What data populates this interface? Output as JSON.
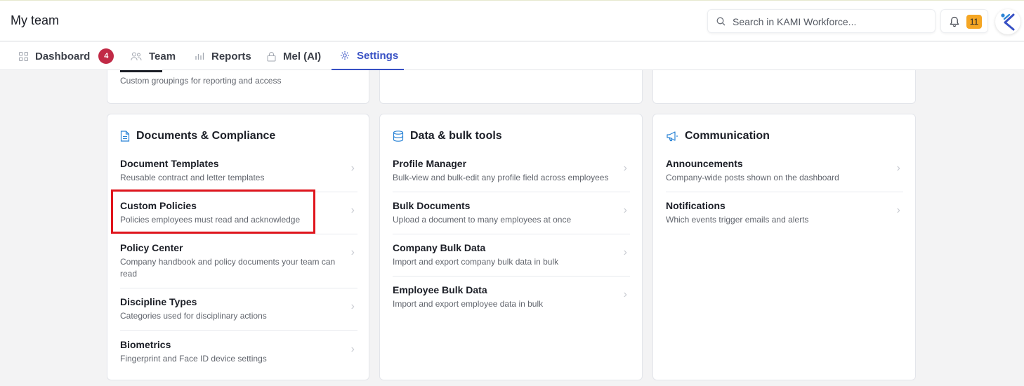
{
  "header": {
    "title": "My team",
    "search_placeholder": "Search in KAMI Workforce...",
    "notification_count": "11"
  },
  "tabs": [
    {
      "label": "Dashboard",
      "badge": "4",
      "icon": "grid-icon"
    },
    {
      "label": "Team",
      "icon": "people-icon"
    },
    {
      "label": "Reports",
      "icon": "bar-chart-icon"
    },
    {
      "label": "Mel (AI)",
      "icon": "lock-icon"
    },
    {
      "label": "Settings",
      "icon": "gear-icon",
      "active": true
    }
  ],
  "top_cards": {
    "left_desc": "Custom groupings for reporting and access"
  },
  "cards": {
    "documents": {
      "title": "Documents & Compliance",
      "icon": "document-icon",
      "items": [
        {
          "name": "Document Templates",
          "desc": "Reusable contract and letter templates"
        },
        {
          "name": "Custom Policies",
          "desc": "Policies employees must read and acknowledge"
        },
        {
          "name": "Policy Center",
          "desc": "Company handbook and policy documents your team can read"
        },
        {
          "name": "Discipline Types",
          "desc": "Categories used for disciplinary actions"
        },
        {
          "name": "Biometrics",
          "desc": "Fingerprint and Face ID device settings"
        }
      ]
    },
    "data": {
      "title": "Data & bulk tools",
      "icon": "database-icon",
      "items": [
        {
          "name": "Profile Manager",
          "desc": "Bulk-view and bulk-edit any profile field across employees"
        },
        {
          "name": "Bulk Documents",
          "desc": "Upload a document to many employees at once"
        },
        {
          "name": "Company Bulk Data",
          "desc": "Import and export company bulk data in bulk"
        },
        {
          "name": "Employee Bulk Data",
          "desc": "Import and export employee data in bulk"
        }
      ]
    },
    "communication": {
      "title": "Communication",
      "icon": "megaphone-icon",
      "items": [
        {
          "name": "Announcements",
          "desc": "Company-wide posts shown on the dashboard"
        },
        {
          "name": "Notifications",
          "desc": "Which events trigger emails and alerts"
        }
      ]
    }
  },
  "colors": {
    "accent": "#3750c4",
    "badge": "#c12a46",
    "notification_badge": "#f5a623",
    "highlight": "#e0151d",
    "icon_blue": "#2b84d6"
  }
}
